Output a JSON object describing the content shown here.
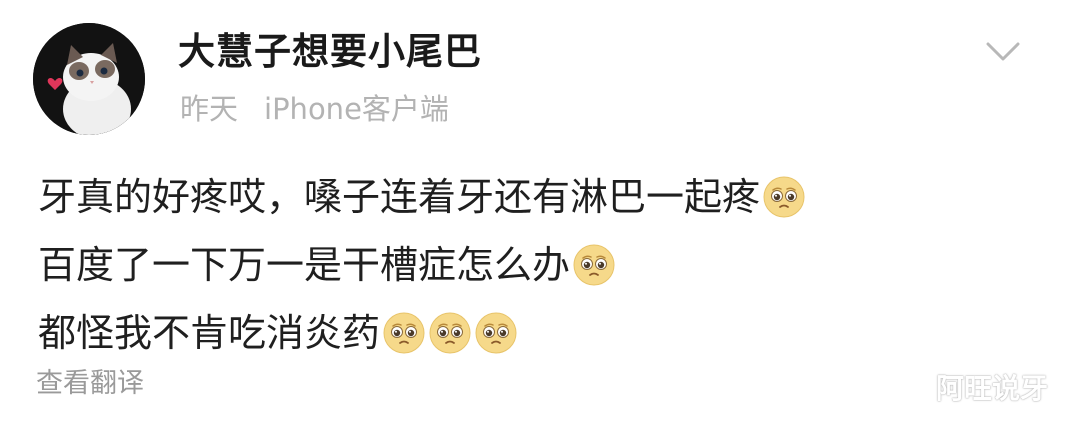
{
  "post": {
    "username": "大慧子想要小尾巴",
    "time": "昨天",
    "source": "iPhone客户端",
    "lines": [
      {
        "text": "牙真的好疼哎，嗓子连着牙还有淋巴一起疼",
        "emoji_count": 1
      },
      {
        "text": "百度了一下万一是干槽症怎么办",
        "emoji_count": 1
      },
      {
        "text": "都怪我不肯吃消炎药",
        "emoji_count": 3
      }
    ],
    "emoji_icon": "pleading-face-emoji-icon",
    "translate_label": "查看翻译",
    "watermark": "阿旺说牙",
    "menu_icon": "chevron-down-icon",
    "avatar_icon": "cat-avatar"
  }
}
